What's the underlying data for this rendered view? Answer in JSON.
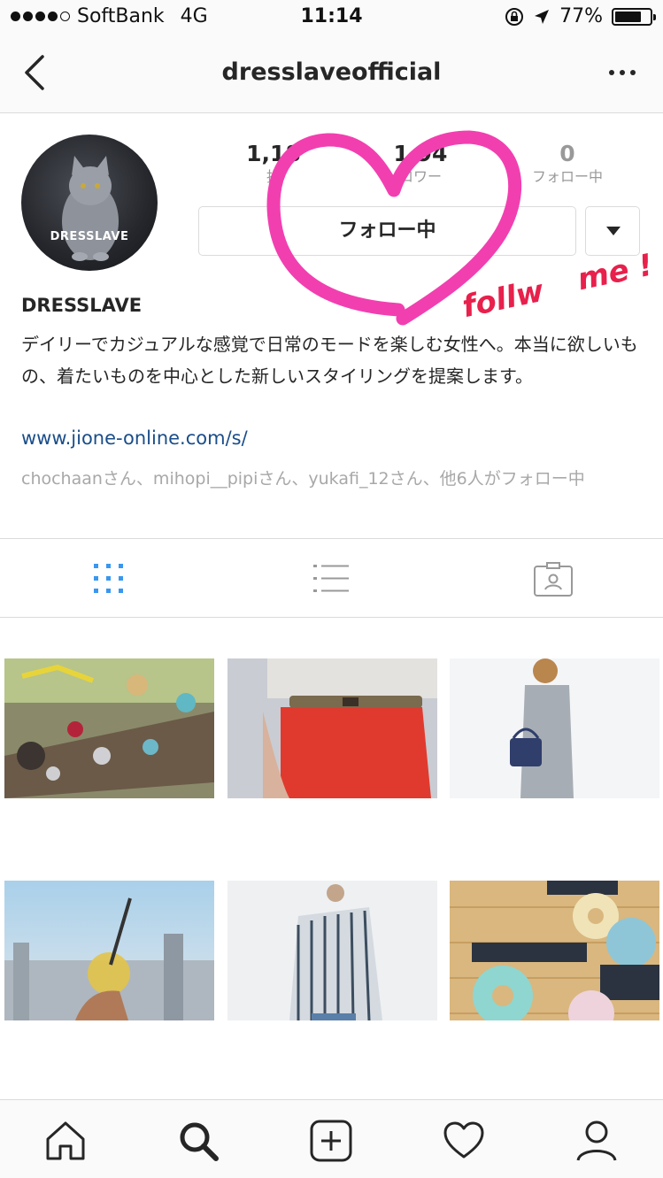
{
  "status_bar": {
    "carrier": "SoftBank",
    "network": "4G",
    "time": "11:14",
    "battery": "77%",
    "battery_level": 0.77
  },
  "nav": {
    "title": "dresslaveofficial"
  },
  "profile": {
    "avatar_text": "DRESSLAVE",
    "stats": [
      {
        "value": "1,18",
        "label": "投"
      },
      {
        "value": "1 94",
        "label": "ロワー"
      },
      {
        "value": "0",
        "label": "フォロー中"
      }
    ],
    "follow_button": "フォロー中",
    "username": "DRESSLAVE",
    "bio": "デイリーでカジュアルな感覚で日常のモードを楽しむ女性へ。本当に欲しいもの、着たいものを中心とした新しいスタイリングを提案します。",
    "link": "www.jione-online.com/s/",
    "followed_by": "chochaanさん、mihopi__pipiさん、yukafi_12さん、他6人がフォロー中"
  },
  "overlay": {
    "text_1": "follw",
    "text_2": "me !",
    "heart_color": "#f23fb0",
    "text_color": "#e8204c"
  },
  "tabs": [
    "grid-icon",
    "list-icon",
    "tagged-icon"
  ],
  "grid": [
    {
      "name": "photo-accessories"
    },
    {
      "name": "photo-red-pants"
    },
    {
      "name": "photo-grey-dress"
    },
    {
      "name": "photo-drink-city"
    },
    {
      "name": "photo-striped-shirt"
    },
    {
      "name": "photo-donut-coasters"
    }
  ],
  "tabbar": [
    "home-icon",
    "search-icon",
    "add-post-icon",
    "activity-heart-icon",
    "profile-icon"
  ],
  "colors": {
    "accent_blue": "#3897f0",
    "link_blue": "#1a4e8a",
    "border": "#dbdbdb"
  }
}
